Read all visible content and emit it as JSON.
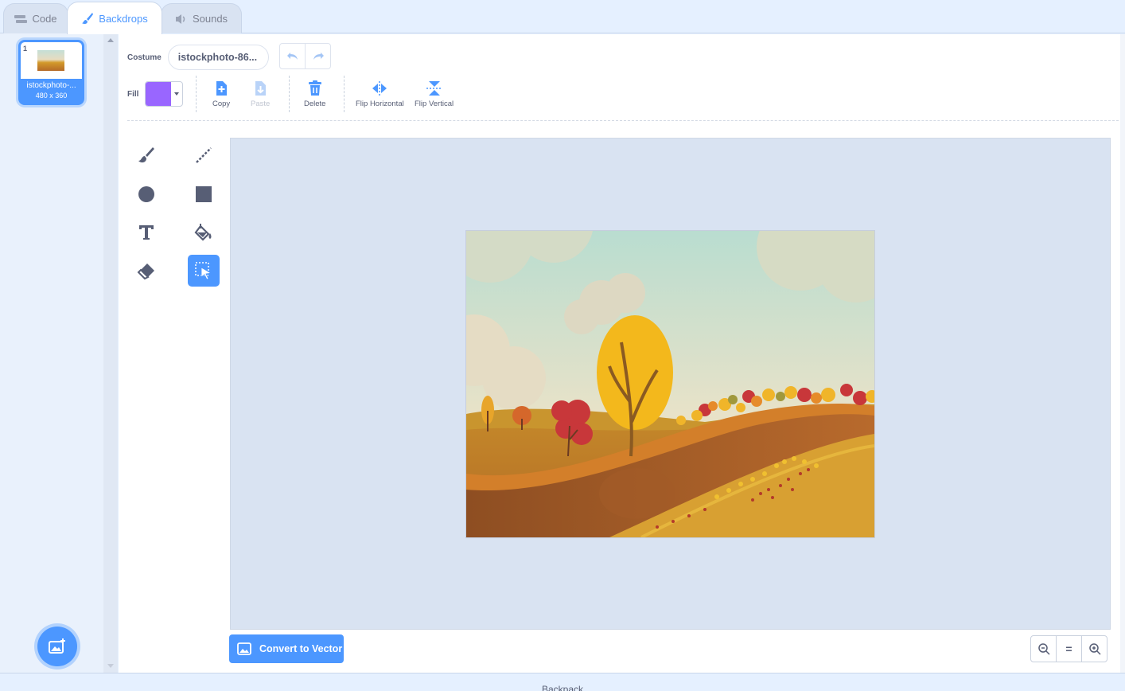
{
  "tabs": [
    {
      "label": "Code",
      "icon": "code-blocks-icon"
    },
    {
      "label": "Backdrops",
      "icon": "paintbrush-icon",
      "active": true
    },
    {
      "label": "Sounds",
      "icon": "speaker-icon"
    }
  ],
  "backdrop_list": {
    "items": [
      {
        "number": "1",
        "name": "istockphoto-...",
        "size": "480 x 360",
        "selected": true
      }
    ],
    "add_button_icon": "add-backdrop-icon"
  },
  "toolbar": {
    "costume_label": "Costume",
    "costume_name": "istockphoto-86...",
    "fill_label": "Fill",
    "fill_color": "#9966ff",
    "copy_label": "Copy",
    "paste_label": "Paste",
    "delete_label": "Delete",
    "flip_horizontal_label": "Flip Horizontal",
    "flip_vertical_label": "Flip Vertical"
  },
  "tools": [
    "brush",
    "line",
    "circle",
    "rectangle",
    "text",
    "fill",
    "eraser",
    "select"
  ],
  "selected_tool": "select",
  "convert_button_label": "Convert to Vector",
  "zoom": {
    "reset_label": "="
  },
  "backpack_label": "Backpack",
  "colors": {
    "accent": "#4c97ff",
    "canvas_bg": "#d9e3f2"
  }
}
